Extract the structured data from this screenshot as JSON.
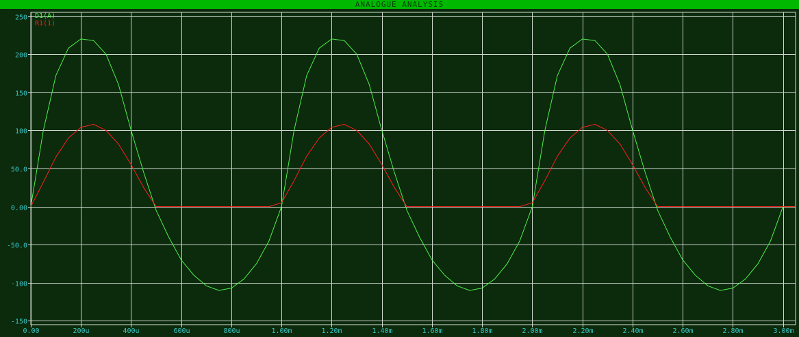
{
  "window": {
    "title": "ANALOGUE ANALYSIS",
    "title_bar_color": "#00b800",
    "background_color": "#0c2a0c",
    "grid_color": "#cfd8cf",
    "tick_label_color": "#39c7c7"
  },
  "chart_data": {
    "type": "line",
    "title": "ANALOGUE ANALYSIS",
    "xlabel": "",
    "ylabel": "",
    "xlim": [
      0,
      0.00305
    ],
    "ylim": [
      -155,
      255
    ],
    "grid": true,
    "legend_position": "top-left",
    "x_ticks": [
      {
        "value": 0.0,
        "label": "0.00"
      },
      {
        "value": 0.0002,
        "label": "200u"
      },
      {
        "value": 0.0004,
        "label": "400u"
      },
      {
        "value": 0.0006,
        "label": "600u"
      },
      {
        "value": 0.0008,
        "label": "800u"
      },
      {
        "value": 0.001,
        "label": "1.00m"
      },
      {
        "value": 0.0012,
        "label": "1.20m"
      },
      {
        "value": 0.0014,
        "label": "1.40m"
      },
      {
        "value": 0.0016,
        "label": "1.60m"
      },
      {
        "value": 0.0018,
        "label": "1.80m"
      },
      {
        "value": 0.002,
        "label": "2.00m"
      },
      {
        "value": 0.0022,
        "label": "2.20m"
      },
      {
        "value": 0.0024,
        "label": "2.40m"
      },
      {
        "value": 0.0026,
        "label": "2.60m"
      },
      {
        "value": 0.0028,
        "label": "2.80m"
      },
      {
        "value": 0.003,
        "label": "3.00m"
      }
    ],
    "y_ticks": [
      {
        "value": 250,
        "label": "250"
      },
      {
        "value": 200,
        "label": "200"
      },
      {
        "value": 150,
        "label": "150"
      },
      {
        "value": 100,
        "label": "100"
      },
      {
        "value": 50,
        "label": "50.0"
      },
      {
        "value": 0,
        "label": "0.00"
      },
      {
        "value": -50,
        "label": "-50.0"
      },
      {
        "value": -100,
        "label": "-100"
      },
      {
        "value": -150,
        "label": "-150"
      }
    ],
    "series": [
      {
        "name": "D1(A)",
        "color": "#4cf04c",
        "x": [
          0,
          5e-05,
          0.0001,
          0.00015,
          0.0002,
          0.00025,
          0.0003,
          0.00035,
          0.0004,
          0.00045,
          0.0005,
          0.00055,
          0.0006,
          0.00065,
          0.0007,
          0.00075,
          0.0008,
          0.00085,
          0.0009,
          0.00095,
          0.001,
          0.00105,
          0.0011,
          0.00115,
          0.0012,
          0.00125,
          0.0013,
          0.00135,
          0.0014,
          0.00145,
          0.0015,
          0.00155,
          0.0016,
          0.00165,
          0.0017,
          0.00175,
          0.0018,
          0.00185,
          0.0019,
          0.00195,
          0.002,
          0.00205,
          0.0021,
          0.00215,
          0.0022,
          0.00225,
          0.0023,
          0.00235,
          0.0024,
          0.00245,
          0.0025,
          0.00255,
          0.0026,
          0.00265,
          0.0027,
          0.00275,
          0.0028,
          0.00285,
          0.0029,
          0.00295,
          0.003,
          0.00305
        ],
        "y": [
          0,
          100,
          172,
          208,
          220,
          218,
          200,
          160,
          100,
          45,
          -5,
          -40,
          -70,
          -90,
          -104,
          -110,
          -107,
          -95,
          -75,
          -45,
          0,
          100,
          172,
          208,
          220,
          218,
          200,
          160,
          100,
          45,
          -5,
          -40,
          -70,
          -90,
          -104,
          -110,
          -107,
          -95,
          -75,
          -45,
          0,
          100,
          172,
          208,
          220,
          218,
          200,
          160,
          100,
          45,
          -5,
          -40,
          -70,
          -90,
          -104,
          -110,
          -107,
          -95,
          -75,
          -45,
          0,
          0
        ]
      },
      {
        "name": "R1(1)",
        "color": "#ff2020",
        "x": [
          0,
          5e-05,
          0.0001,
          0.00015,
          0.0002,
          0.00025,
          0.0003,
          0.00035,
          0.0004,
          0.00045,
          0.0005,
          0.00055,
          0.0006,
          0.00065,
          0.0007,
          0.00075,
          0.0008,
          0.00085,
          0.0009,
          0.00095,
          0.001,
          0.00105,
          0.0011,
          0.00115,
          0.0012,
          0.00125,
          0.0013,
          0.00135,
          0.0014,
          0.00145,
          0.0015,
          0.00155,
          0.0016,
          0.00165,
          0.0017,
          0.00175,
          0.0018,
          0.00185,
          0.0019,
          0.00195,
          0.002,
          0.00205,
          0.0021,
          0.00215,
          0.0022,
          0.00225,
          0.0023,
          0.00235,
          0.0024,
          0.00245,
          0.0025,
          0.00255,
          0.0026,
          0.00265,
          0.0027,
          0.00275,
          0.0028,
          0.00285,
          0.0029,
          0.00295,
          0.003,
          0.00305
        ],
        "y": [
          0,
          32,
          65,
          90,
          104,
          108,
          100,
          82,
          55,
          25,
          0,
          0,
          0,
          0,
          0,
          0,
          0,
          0,
          0,
          0,
          5,
          34,
          66,
          90,
          104,
          108,
          100,
          82,
          55,
          25,
          0,
          0,
          0,
          0,
          0,
          0,
          0,
          0,
          0,
          0,
          5,
          34,
          66,
          90,
          104,
          108,
          100,
          82,
          55,
          25,
          0,
          0,
          0,
          0,
          0,
          0,
          0,
          0,
          0,
          0,
          0,
          0
        ]
      }
    ]
  }
}
